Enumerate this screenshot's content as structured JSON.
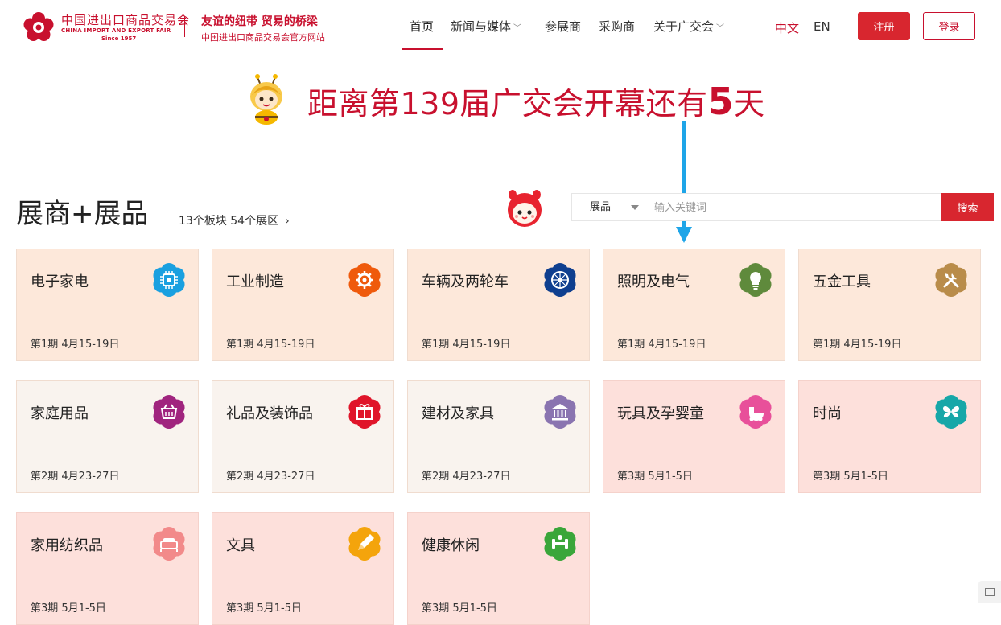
{
  "brand": {
    "cn_name": "中国进出口商品交易会",
    "en_name": "CHINA IMPORT AND EXPORT FAIR",
    "since": "Since 1957",
    "slogan": "友谊的纽带 贸易的桥梁",
    "subslogan": "中国进出口商品交易会官方网站",
    "color": "#c8102e"
  },
  "nav": {
    "items": [
      {
        "label": "首页",
        "active": true
      },
      {
        "label": "新闻与媒体",
        "dropdown": true
      },
      {
        "label": "参展商"
      },
      {
        "label": "采购商"
      },
      {
        "label": "关于广交会",
        "dropdown": true
      }
    ],
    "lang_zh": "中文",
    "lang_en": "EN",
    "register": "注册",
    "login": "登录"
  },
  "countdown": {
    "prefix": "距离第139届广交会开幕还有",
    "days": "5",
    "suffix": "天"
  },
  "section": {
    "title": "展商+展品",
    "summary": "13个板块 54个展区",
    "summary_arrow": "›"
  },
  "search": {
    "scope": "展品",
    "placeholder": "输入关键词",
    "button": "搜索"
  },
  "categories": [
    {
      "name": "电子家电",
      "date": "第1期 4月15-19日",
      "icon": "chip-icon",
      "color": "#1aa0e0",
      "tone": "peach"
    },
    {
      "name": "工业制造",
      "date": "第1期 4月15-19日",
      "icon": "gear-icon",
      "color": "#ef5a0c",
      "tone": "peach"
    },
    {
      "name": "车辆及两轮车",
      "date": "第1期 4月15-19日",
      "icon": "wheel-icon",
      "color": "#0f3f8f",
      "tone": "peach"
    },
    {
      "name": "照明及电气",
      "date": "第1期 4月15-19日",
      "icon": "bulb-icon",
      "color": "#5f8a3c",
      "tone": "peach"
    },
    {
      "name": "五金工具",
      "date": "第1期 4月15-19日",
      "icon": "tools-icon",
      "color": "#b98c4a",
      "tone": "peach"
    },
    {
      "name": "家庭用品",
      "date": "第2期 4月23-27日",
      "icon": "basket-icon",
      "color": "#a0247e",
      "tone": "cream"
    },
    {
      "name": "礼品及装饰品",
      "date": "第2期 4月23-27日",
      "icon": "gift-icon",
      "color": "#e0152a",
      "tone": "cream"
    },
    {
      "name": "建材及家具",
      "date": "第2期 4月23-27日",
      "icon": "building-icon",
      "color": "#8a74b0",
      "tone": "cream"
    },
    {
      "name": "玩具及孕婴童",
      "date": "第3期 5月1-5日",
      "icon": "stroller-icon",
      "color": "#e8509a",
      "tone": "pink"
    },
    {
      "name": "时尚",
      "date": "第3期 5月1-5日",
      "icon": "butterfly-icon",
      "color": "#16a7a8",
      "tone": "pink"
    },
    {
      "name": "家用纺织品",
      "date": "第3期 5月1-5日",
      "icon": "bed-icon",
      "color": "#f28a8a",
      "tone": "pink"
    },
    {
      "name": "文具",
      "date": "第3期 5月1-5日",
      "icon": "pencil-icon",
      "color": "#f4a40c",
      "tone": "pink"
    },
    {
      "name": "健康休闲",
      "date": "第3期 5月1-5日",
      "icon": "fitness-icon",
      "color": "#3aa63a",
      "tone": "pink"
    }
  ]
}
